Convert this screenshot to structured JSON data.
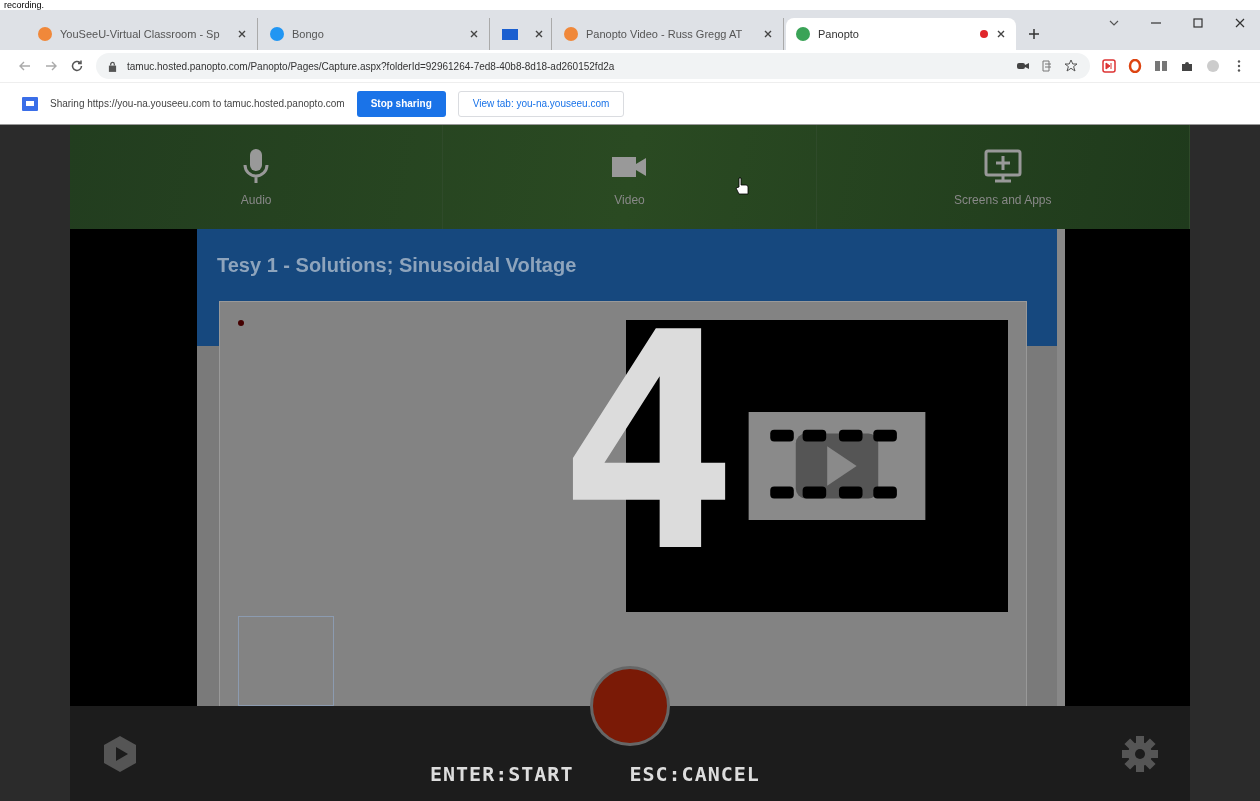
{
  "caption": "recording.",
  "tabs": [
    {
      "title": "YouSeeU-Virtual Classroom - Sp",
      "selected": false,
      "recording": false
    },
    {
      "title": "Bongo",
      "selected": false,
      "recording": false
    },
    {
      "selected": false,
      "recording": false
    },
    {
      "title": "Panopto Video - Russ Gregg AT",
      "selected": false,
      "recording": false
    },
    {
      "title": "Panopto",
      "selected": true,
      "recording": true
    }
  ],
  "address": {
    "url": "tamuc.hosted.panopto.com/Panopto/Pages/Capture.aspx?folderId=92961264-7ed8-40b8-8d18-ad260152fd2a"
  },
  "sharing_bar": {
    "message": "Sharing https://you-na.youseeu.com to tamuc.hosted.panopto.com",
    "buttons": [
      {
        "label": "Stop sharing",
        "kind": "primary"
      },
      {
        "label": "View tab: you-na.youseeu.com",
        "kind": "secondary"
      }
    ]
  },
  "sources": [
    {
      "label": "Audio",
      "kind": "audio"
    },
    {
      "label": "Video",
      "kind": "video"
    },
    {
      "label": "Screens and Apps",
      "kind": "screens"
    }
  ],
  "shared_screen": {
    "title": "Tesy 1 - Solutions; Sinusoidal Voltage"
  },
  "countdown": "4",
  "controls": {
    "start": "ENTER:START",
    "cancel": "ESC:CANCEL"
  }
}
